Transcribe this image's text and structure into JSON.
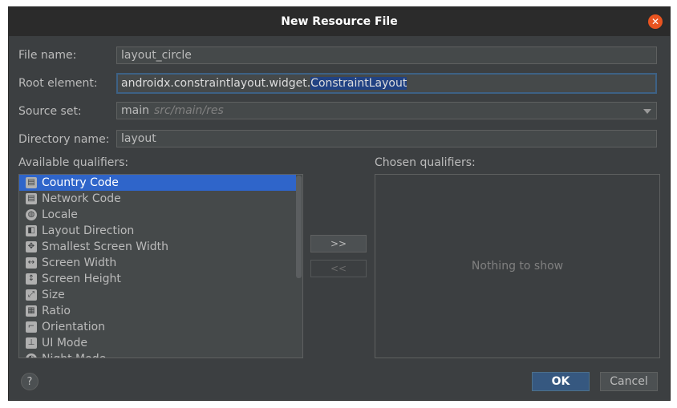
{
  "window": {
    "title": "New Resource File"
  },
  "form": {
    "file_name": {
      "label": "File name:",
      "value": "layout_circle"
    },
    "root_element": {
      "label": "Root element:",
      "value_prefix": "androidx.constraintlayout.widget.",
      "value_selected": "ConstraintLayout"
    },
    "source_set": {
      "label": "Source set:",
      "value": "main",
      "hint": "src/main/res"
    },
    "directory_name": {
      "label": "Directory name:",
      "value": "layout"
    }
  },
  "qualifiers": {
    "available_label": "Available qualifiers:",
    "chosen_label": "Chosen qualifiers:",
    "empty_text": "Nothing to show",
    "items": [
      {
        "label": "Country Code",
        "icon": "country-code-icon",
        "selected": true
      },
      {
        "label": "Network Code",
        "icon": "network-code-icon"
      },
      {
        "label": "Locale",
        "icon": "globe-icon"
      },
      {
        "label": "Layout Direction",
        "icon": "layout-direction-icon"
      },
      {
        "label": "Smallest Screen Width",
        "icon": "smallest-width-icon"
      },
      {
        "label": "Screen Width",
        "icon": "screen-width-icon"
      },
      {
        "label": "Screen Height",
        "icon": "screen-height-icon"
      },
      {
        "label": "Size",
        "icon": "size-icon"
      },
      {
        "label": "Ratio",
        "icon": "ratio-icon"
      },
      {
        "label": "Orientation",
        "icon": "orientation-icon"
      },
      {
        "label": "UI Mode",
        "icon": "ui-mode-icon"
      },
      {
        "label": "Night Mode",
        "icon": "night-mode-icon"
      }
    ],
    "add_label": ">>",
    "remove_label": "<<"
  },
  "buttons": {
    "help": "?",
    "ok": "OK",
    "cancel": "Cancel"
  },
  "colors": {
    "accent": "#2f65ca",
    "primary_button": "#365880",
    "close": "#e95420"
  }
}
